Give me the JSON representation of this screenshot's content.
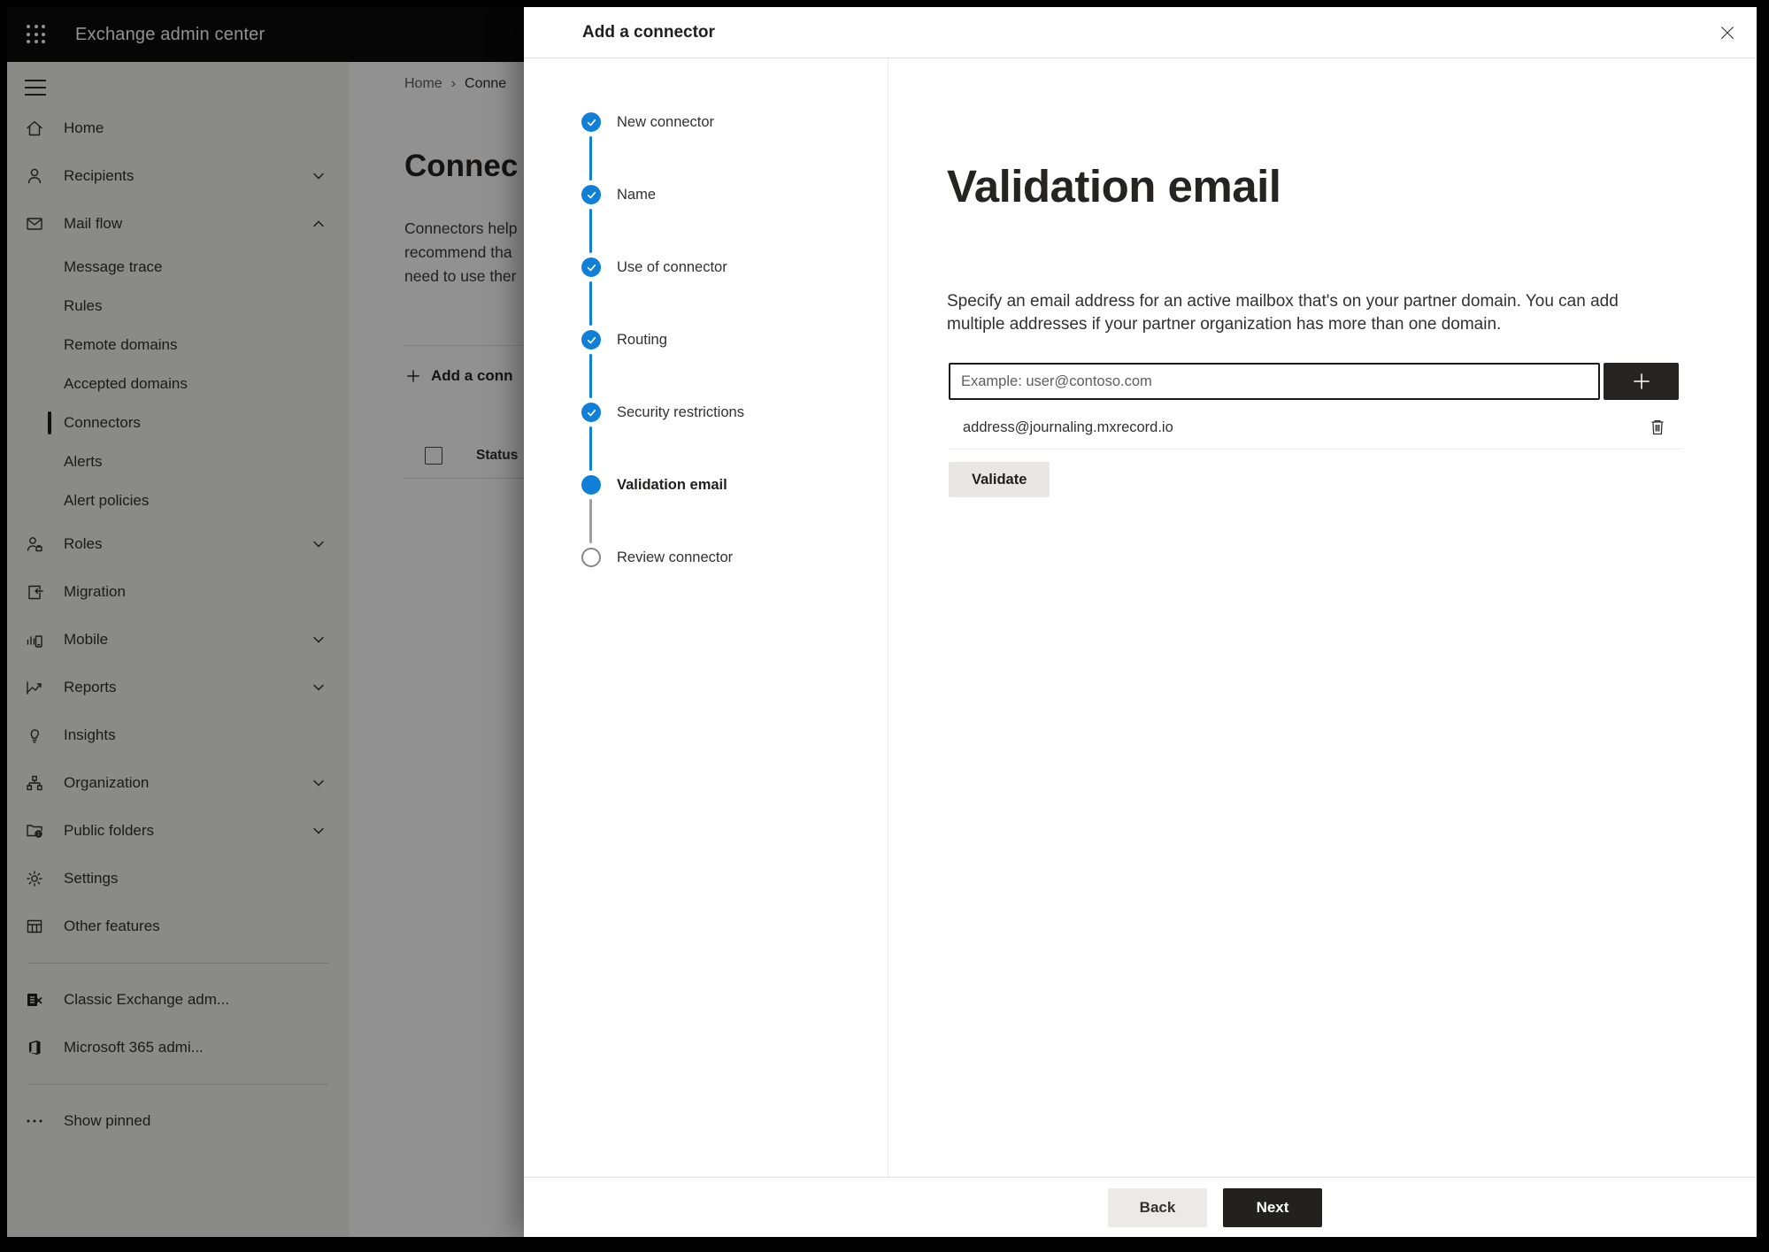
{
  "topbar": {
    "title": "Exchange admin center",
    "app_launcher_icon": "waffle-icon"
  },
  "sidebar": {
    "menu_icon": "hamburger-icon",
    "items": [
      {
        "label": "Home",
        "icon": "home"
      },
      {
        "label": "Recipients",
        "icon": "person",
        "chevron": "down"
      },
      {
        "label": "Mail flow",
        "icon": "mail",
        "chevron": "up",
        "expanded": true
      },
      {
        "label": "Message trace",
        "sub": true
      },
      {
        "label": "Rules",
        "sub": true
      },
      {
        "label": "Remote domains",
        "sub": true
      },
      {
        "label": "Accepted domains",
        "sub": true
      },
      {
        "label": "Connectors",
        "sub": true,
        "selected": true
      },
      {
        "label": "Alerts",
        "sub": true
      },
      {
        "label": "Alert policies",
        "sub": true
      },
      {
        "label": "Roles",
        "icon": "roles",
        "chevron": "down"
      },
      {
        "label": "Migration",
        "icon": "migration"
      },
      {
        "label": "Mobile",
        "icon": "mobile",
        "chevron": "down"
      },
      {
        "label": "Reports",
        "icon": "reports",
        "chevron": "down"
      },
      {
        "label": "Insights",
        "icon": "insights"
      },
      {
        "label": "Organization",
        "icon": "organization",
        "chevron": "down"
      },
      {
        "label": "Public folders",
        "icon": "folders",
        "chevron": "down"
      },
      {
        "label": "Settings",
        "icon": "settings"
      },
      {
        "label": "Other features",
        "icon": "grid"
      },
      {
        "divider": true
      },
      {
        "label": "Classic Exchange adm...",
        "icon": "exchange"
      },
      {
        "label": "Microsoft 365 admi...",
        "icon": "office"
      },
      {
        "divider": true
      },
      {
        "label": "Show pinned",
        "icon": "ellipsis"
      }
    ]
  },
  "page": {
    "breadcrumb": {
      "home": "Home",
      "separator": "›",
      "current": "Conne"
    },
    "title": "Connec",
    "description_lines": [
      "Connectors help",
      "recommend tha",
      "need to use ther"
    ],
    "add_button_label": "Add a conn",
    "table": {
      "status_header": "Status"
    }
  },
  "dialog": {
    "title": "Add a connector",
    "close_icon": "close-icon",
    "steps": [
      {
        "label": "New connector",
        "state": "done"
      },
      {
        "label": "Name",
        "state": "done"
      },
      {
        "label": "Use of connector",
        "state": "done"
      },
      {
        "label": "Routing",
        "state": "done"
      },
      {
        "label": "Security restrictions",
        "state": "done"
      },
      {
        "label": "Validation email",
        "state": "active"
      },
      {
        "label": "Review connector",
        "state": "todo"
      }
    ],
    "content": {
      "heading": "Validation email",
      "description": "Specify an email address for an active mailbox that's on your partner domain. You can add multiple addresses if your partner organization has more than one domain.",
      "email_input": {
        "value": "",
        "placeholder": "Example: user@contoso.com"
      },
      "add_icon": "plus",
      "emails": [
        {
          "address": "address@journaling.mxrecord.io",
          "delete_icon": "trash"
        }
      ],
      "validate_button": "Validate"
    },
    "footer": {
      "back": "Back",
      "next": "Next"
    }
  },
  "colors": {
    "accent_blue": "#0f7fd8",
    "topbar_bg": "#0b0b0b",
    "sidebar_bg": "#f3f2f1",
    "dark_button_bg": "#222120",
    "light_button_bg": "#eceae8",
    "todo_gray": "#8a8886"
  }
}
